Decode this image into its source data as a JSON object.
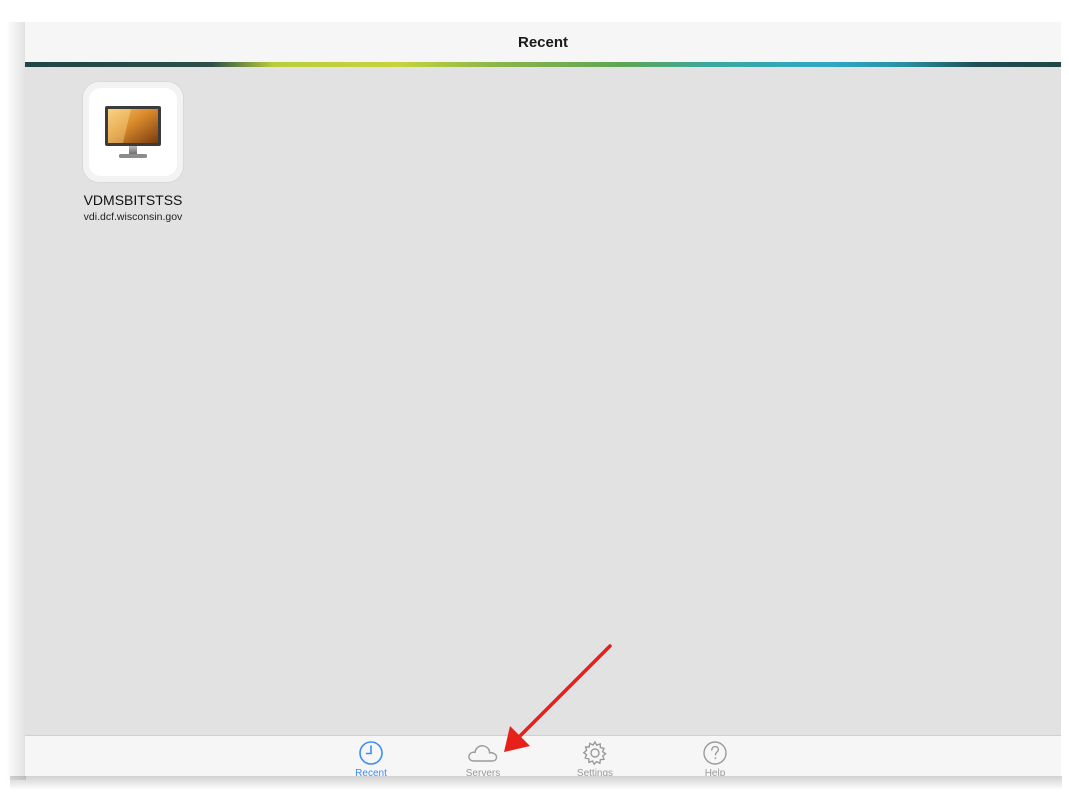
{
  "navbar": {
    "title": "Recent"
  },
  "recent": {
    "items": [
      {
        "name": "VDMSBITSTSS",
        "server": "vdi.dcf.wisconsin.gov",
        "icon": "desktop-monitor-icon"
      }
    ]
  },
  "tabbar": {
    "tabs": [
      {
        "label": "Recent",
        "icon": "clock-icon",
        "active": true
      },
      {
        "label": "Servers",
        "icon": "cloud-icon",
        "active": false
      },
      {
        "label": "Settings",
        "icon": "gear-icon",
        "active": false
      },
      {
        "label": "Help",
        "icon": "question-icon",
        "active": false
      }
    ]
  },
  "colors": {
    "accent": "#3a8ef6",
    "inactive": "#9a9a9a",
    "background": "#e2e2e2",
    "annotation_arrow": "#e8201c"
  }
}
